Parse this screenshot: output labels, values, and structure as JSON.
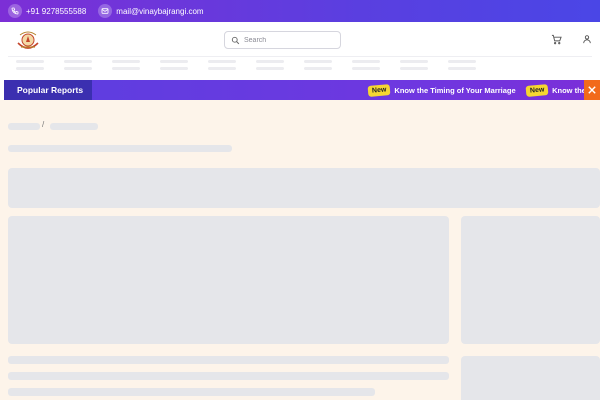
{
  "topbar": {
    "phone": "+91 9278555588",
    "email": "mail@vinaybajrangi.com",
    "phone_icon": "phone-icon",
    "email_icon": "mail-icon"
  },
  "header": {
    "search_placeholder": "Search",
    "search_value": ""
  },
  "reports_bar": {
    "label": "Popular Reports",
    "items": [
      {
        "badge": "New",
        "text": "Know the Timing of Your Marriage"
      },
      {
        "badge": "New",
        "text": "Know the pe"
      }
    ],
    "close_icon": "close-icon"
  },
  "breadcrumb": {
    "separator": "/"
  },
  "colors": {
    "top_gradient_start": "#7c2fd6",
    "top_gradient_end": "#4a46e6",
    "reports_label_bg": "#3b2fb0",
    "badge": "#f5d632",
    "close": "#f26a1b",
    "content_bg": "#fdf4ea",
    "skeleton": "#e5e6ea"
  }
}
